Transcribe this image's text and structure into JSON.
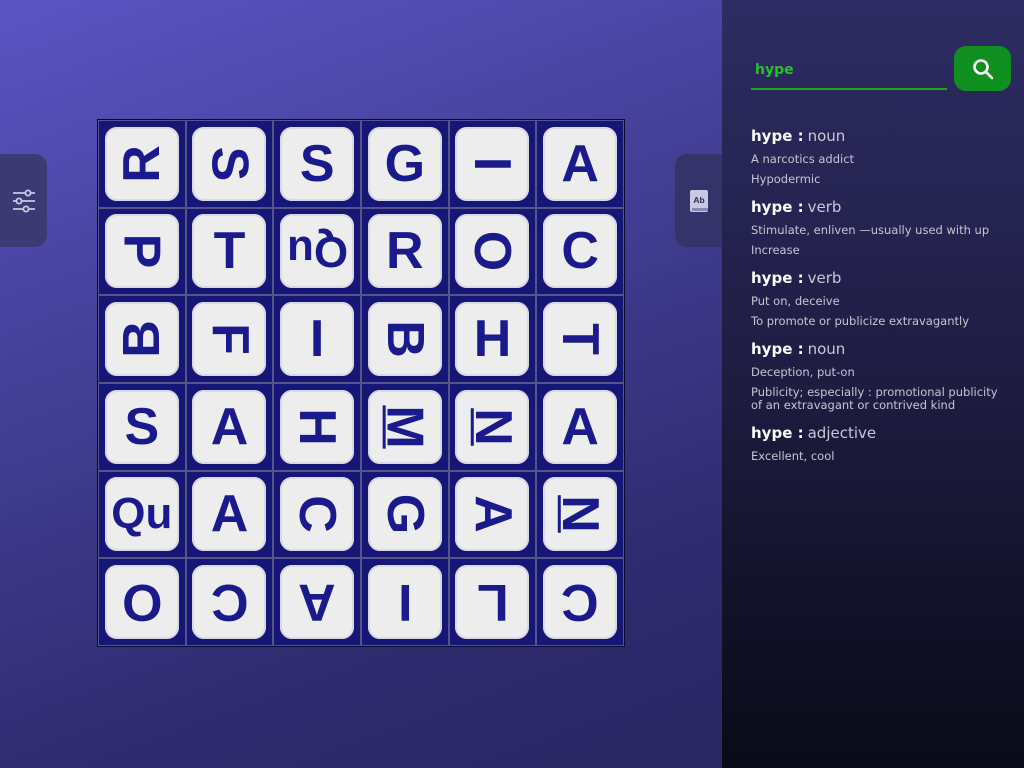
{
  "board": {
    "rows": [
      [
        {
          "l": "R",
          "rot": 270
        },
        {
          "l": "S",
          "rot": 90
        },
        {
          "l": "S",
          "rot": 0
        },
        {
          "l": "G",
          "rot": 0
        },
        {
          "l": "I",
          "rot": 90
        },
        {
          "l": "A",
          "rot": 0
        }
      ],
      [
        {
          "l": "P",
          "rot": 90
        },
        {
          "l": "T",
          "rot": 0
        },
        {
          "l": "Qu",
          "rot": 180
        },
        {
          "l": "R",
          "rot": 0
        },
        {
          "l": "O",
          "rot": 90
        },
        {
          "l": "C",
          "rot": 0
        }
      ],
      [
        {
          "l": "B",
          "rot": 270
        },
        {
          "l": "F",
          "rot": 90
        },
        {
          "l": "I",
          "rot": 0
        },
        {
          "l": "B",
          "rot": 90
        },
        {
          "l": "H",
          "rot": 0
        },
        {
          "l": "T",
          "rot": 90
        }
      ],
      [
        {
          "l": "S",
          "rot": 0
        },
        {
          "l": "A",
          "rot": 0
        },
        {
          "l": "H",
          "rot": 90
        },
        {
          "l": "M",
          "rot": 90
        },
        {
          "l": "N",
          "rot": 90
        },
        {
          "l": "A",
          "rot": 0
        }
      ],
      [
        {
          "l": "Qu",
          "rot": 0
        },
        {
          "l": "A",
          "rot": 0
        },
        {
          "l": "C",
          "rot": 90
        },
        {
          "l": "G",
          "rot": 90
        },
        {
          "l": "A",
          "rot": 90
        },
        {
          "l": "N",
          "rot": 90
        }
      ],
      [
        {
          "l": "O",
          "rot": 180
        },
        {
          "l": "C",
          "rot": 180
        },
        {
          "l": "A",
          "rot": 180
        },
        {
          "l": "I",
          "rot": 180
        },
        {
          "l": "L",
          "rot": 180
        },
        {
          "l": "C",
          "rot": 180
        }
      ]
    ]
  },
  "search": {
    "value": "hype"
  },
  "icons": {
    "settings": "sliders-icon",
    "dictionary": "dictionary-book-icon",
    "search": "search-icon"
  },
  "colors": {
    "accent": "#0f8f1f",
    "die_face": "#ededed",
    "die_letter": "#1a1a8c",
    "board": "#161676"
  },
  "definitions": [
    {
      "word": "hype",
      "pos": "noun",
      "meanings": [
        "A narcotics addict",
        "Hypodermic"
      ]
    },
    {
      "word": "hype",
      "pos": "verb",
      "meanings": [
        "Stimulate, enliven —usually used with up",
        "Increase"
      ]
    },
    {
      "word": "hype",
      "pos": "verb",
      "meanings": [
        "Put on, deceive",
        "To promote or publicize extravagantly"
      ]
    },
    {
      "word": "hype",
      "pos": "noun",
      "meanings": [
        "Deception, put-on",
        "Publicity; especially : promotional publicity of an extravagant or contrived kind"
      ]
    },
    {
      "word": "hype",
      "pos": "adjective",
      "meanings": [
        "Excellent, cool"
      ]
    }
  ]
}
